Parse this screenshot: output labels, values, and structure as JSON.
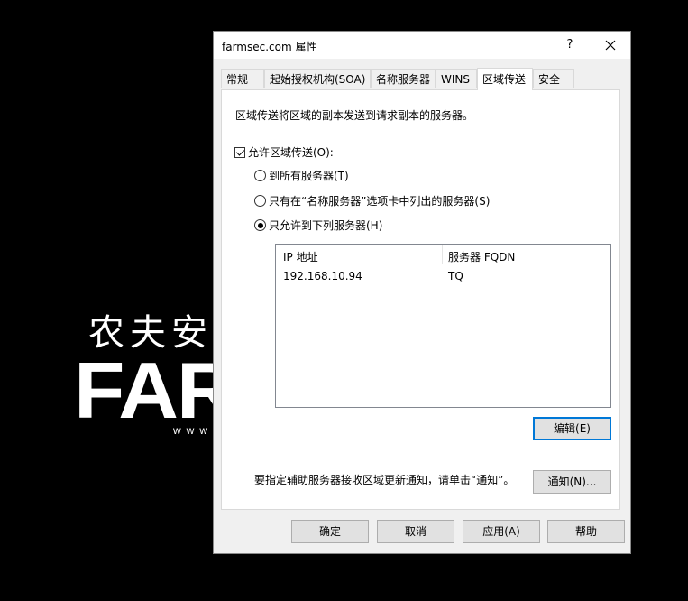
{
  "background": {
    "logo_cn": "农夫安全",
    "logo_big": "FARMSEC",
    "logo_url": "www.farmsec.com"
  },
  "dialog": {
    "title": "farmsec.com 属性",
    "help_glyph": "?",
    "tabs": [
      {
        "label": "常规"
      },
      {
        "label": "起始授权机构(SOA)"
      },
      {
        "label": "名称服务器"
      },
      {
        "label": "WINS"
      },
      {
        "label": "区域传送"
      },
      {
        "label": "安全"
      }
    ],
    "active_tab": "区域传送",
    "description": "区域传送将区域的副本发送到请求副本的服务器。",
    "allow_transfer": {
      "label": "允许区域传送(O):",
      "checked": true
    },
    "radios": [
      {
        "label": "到所有服务器(T)",
        "checked": false
      },
      {
        "label": "只有在“名称服务器”选项卡中列出的服务器(S)",
        "checked": false
      },
      {
        "label": "只允许到下列服务器(H)",
        "checked": true
      }
    ],
    "server_list": {
      "columns": [
        "IP 地址",
        "服务器 FQDN"
      ],
      "rows": [
        {
          "ip": "192.168.10.94",
          "fqdn": "TQ"
        }
      ]
    },
    "edit_button": "编辑(E)",
    "notify_text": "要指定辅助服务器接收区域更新通知，请单击“通知”。",
    "notify_button": "通知(N)...",
    "footer_buttons": {
      "ok": "确定",
      "cancel": "取消",
      "apply": "应用(A)",
      "help": "帮助"
    }
  }
}
